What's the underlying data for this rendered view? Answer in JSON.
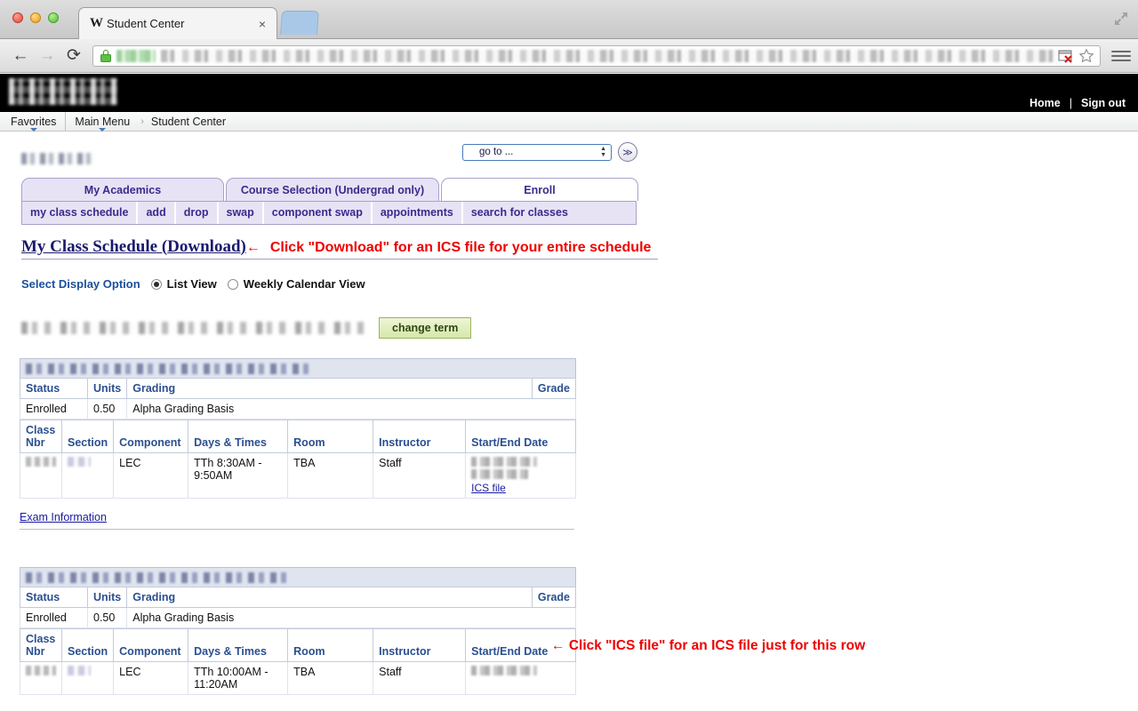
{
  "browser": {
    "tab_title": "Student Center",
    "favicon_letter": "W",
    "close_label": "×",
    "back_icon": "←",
    "forward_icon": "→",
    "reload_icon": "⟳",
    "url_masked": true
  },
  "header": {
    "home_label": "Home",
    "separator": "|",
    "signout_label": "Sign out"
  },
  "breadcrumb": {
    "favorites_label": "Favorites",
    "main_menu_label": "Main Menu",
    "separator": "›",
    "current_label": "Student Center"
  },
  "goto": {
    "selected": "go to ...",
    "go_button": "≫"
  },
  "tabs": {
    "main": [
      {
        "label": "My Academics",
        "active": false
      },
      {
        "label": "Course Selection (Undergrad only)",
        "active": false
      },
      {
        "label": "Enroll",
        "active": true
      }
    ],
    "sub": [
      {
        "label": "my class schedule"
      },
      {
        "label": "add"
      },
      {
        "label": "drop"
      },
      {
        "label": "swap"
      },
      {
        "label": "component swap"
      },
      {
        "label": "appointments"
      },
      {
        "label": "search for classes"
      }
    ]
  },
  "heading": {
    "title_prefix": "My Class Schedule (",
    "download_link": "Download",
    "title_suffix": ")",
    "arrow": "←",
    "annotation": "Click \"Download\" for an ICS file for your entire schedule"
  },
  "display_option": {
    "label": "Select Display Option",
    "options": [
      {
        "label": "List View",
        "selected": true
      },
      {
        "label": "Weekly Calendar View",
        "selected": false
      }
    ]
  },
  "term": {
    "change_term_label": "change term"
  },
  "courses": [
    {
      "status_headers": [
        "Status",
        "Units",
        "Grading",
        "Grade"
      ],
      "status_values": [
        "Enrolled",
        "0.50",
        "Alpha Grading Basis",
        ""
      ],
      "class_headers": [
        "Class Nbr",
        "Section",
        "Component",
        "Days & Times",
        "Room",
        "Instructor",
        "Start/End Date"
      ],
      "rows": [
        {
          "component": "LEC",
          "days_times": "TTh 8:30AM - 9:50AM",
          "room": "TBA",
          "instructor": "Staff",
          "ics_link": "ICS file"
        }
      ],
      "exam_link": "Exam Information",
      "row_annotation": {
        "arrow": "←",
        "text": "Click \"ICS file\" for an ICS file just for this row"
      }
    },
    {
      "status_headers": [
        "Status",
        "Units",
        "Grading",
        "Grade"
      ],
      "status_values": [
        "Enrolled",
        "0.50",
        "Alpha Grading Basis",
        ""
      ],
      "class_headers": [
        "Class Nbr",
        "Section",
        "Component",
        "Days & Times",
        "Room",
        "Instructor",
        "Start/End Date"
      ],
      "rows": [
        {
          "component": "LEC",
          "days_times": "TTh 10:00AM - 11:20AM",
          "room": "TBA",
          "instructor": "Staff",
          "ics_link": ""
        }
      ]
    }
  ],
  "colors": {
    "tab_purple": "#3b2a8c",
    "tab_bg": "#e7e3f5",
    "annotation_red": "#ee0000",
    "link_blue": "#1a1aa0",
    "header_blue": "#2a4f8f",
    "title_navy": "#1a1a6e",
    "green_button": "#d6e8a8"
  }
}
